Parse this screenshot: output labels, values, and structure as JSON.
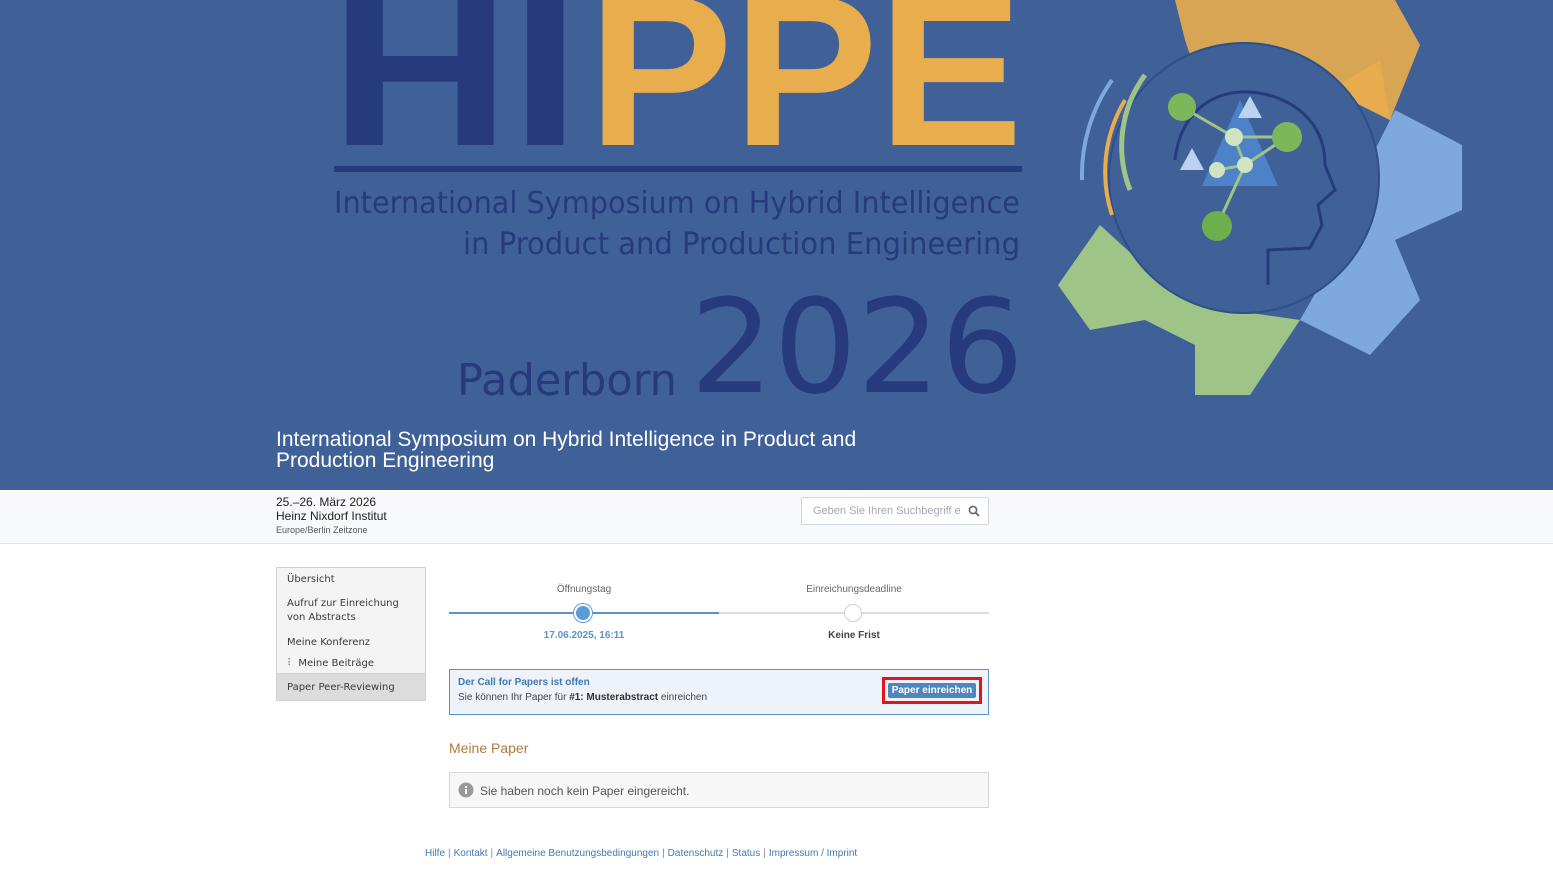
{
  "banner": {
    "logo_text_dark": "HI",
    "logo_text_light": "PPE",
    "subtitle_line1": "International Symposium on Hybrid Intelligence",
    "subtitle_line2": "in Product and Production Engineering",
    "city": "Paderborn",
    "year": "2026",
    "conference_title": "International Symposium on Hybrid Intelligence in Product and Production Engineering",
    "colors": {
      "background": "#3f6198",
      "dark_blue": "#263a7c",
      "gold": "#e8ad4d",
      "light_blue": "#7fa9dc",
      "green": "#9fc487"
    }
  },
  "info": {
    "dates": "25.–26. März 2026",
    "venue": "Heinz Nixdorf Institut",
    "timezone": "Europe/Berlin Zeitzone"
  },
  "search": {
    "placeholder": "Geben Sie Ihren Suchbegriff ein",
    "icon": "search-icon"
  },
  "sidebar": {
    "items": [
      {
        "label": "Übersicht"
      },
      {
        "label": "Aufruf zur Einreichung von Abstracts"
      },
      {
        "label": "Meine Konferenz"
      },
      {
        "label": "Meine Beiträge"
      },
      {
        "label": "Paper Peer-Reviewing"
      }
    ]
  },
  "timeline": {
    "start_label": "Öffnungstag",
    "start_value": "17.06.2025, 16:11",
    "end_label": "Einreichungsdeadline",
    "end_value": "Keine Frist",
    "progress": 0.5
  },
  "cfp": {
    "heading": "Der Call for Papers ist offen",
    "text_prefix": "Sie können Ihr Paper für ",
    "text_bold": "#1: Musterabstract",
    "text_suffix": " einreichen",
    "button_label": "Paper einreichen"
  },
  "my_papers": {
    "title": "Meine Paper",
    "empty_message": "Sie haben noch kein Paper eingereicht."
  },
  "footer": {
    "links": [
      "Hilfe",
      "Kontakt",
      "Allgemeine Benutzungsbedingungen",
      "Datenschutz",
      "Status",
      "Impressum / Imprint"
    ]
  }
}
